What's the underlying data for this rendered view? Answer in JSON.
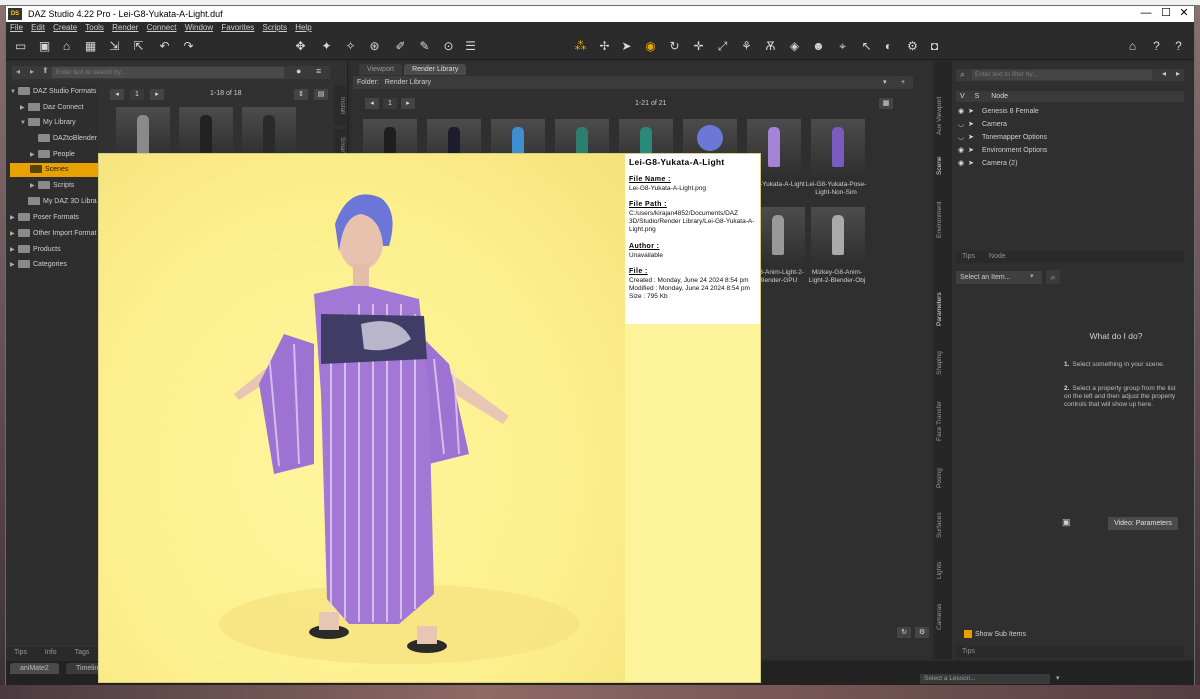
{
  "window": {
    "title": "DAZ Studio 4.22 Pro - Lei-G8-Yukata-A-Light.duf",
    "controls": {
      "minimize": "—",
      "maximize": "☐",
      "close": "✕"
    }
  },
  "menu": [
    "File",
    "Edit",
    "Create",
    "Tools",
    "Render",
    "Connect",
    "Window",
    "Favorites",
    "Scripts",
    "Help"
  ],
  "content_library": {
    "search_placeholder": "Enter text to search by...",
    "page_indicator": "1",
    "page_range": "1-18 of 18",
    "tree": [
      {
        "label": "DAZ Studio Formats",
        "level": 0,
        "selected": false
      },
      {
        "label": "Daz Connect",
        "level": 1,
        "selected": false
      },
      {
        "label": "My Library",
        "level": 1,
        "selected": false
      },
      {
        "label": "DAZtoBlender",
        "level": 2,
        "selected": false
      },
      {
        "label": "People",
        "level": 2,
        "selected": false
      },
      {
        "label": "Scenes",
        "level": 2,
        "selected": true
      },
      {
        "label": "Scripts",
        "level": 2,
        "selected": false
      },
      {
        "label": "My DAZ 3D Libra",
        "level": 1,
        "selected": false
      },
      {
        "label": "Poser Formats",
        "level": 0,
        "selected": false
      },
      {
        "label": "Other Import Format",
        "level": 0,
        "selected": false
      },
      {
        "label": "Products",
        "level": 0,
        "selected": false
      },
      {
        "label": "Categories",
        "level": 0,
        "selected": false
      }
    ],
    "bottom_tabs": [
      "Tips",
      "Info",
      "Tags"
    ],
    "side_tabs": [
      "Install",
      "Smart C"
    ]
  },
  "render_library": {
    "tabs": [
      "Viewport",
      "Render Library"
    ],
    "folder_label": "Folder:",
    "folder_value": "Render Library",
    "page_indicator": "1",
    "page_range": "1-21 of 21",
    "captions": [
      "-G8-Yukata-A-Light",
      "Lei-G8-Yukata-Pose-Light-Non-Sim",
      "-G8-Anim-Light-2-Blender-GPU",
      "Mizkey-G8-Anim-Light-2-Blender-Obj"
    ]
  },
  "scene": {
    "search_placeholder": "Enter text to filter by...",
    "header": {
      "v": "V",
      "s": "S",
      "node": "Node"
    },
    "nodes": [
      "Genesis 8 Female",
      "Camera",
      "Tonemapper Options",
      "Environment Options",
      "Camera (2)"
    ],
    "tabs": [
      "Tips",
      "Node"
    ],
    "side_tabs": [
      "Aux Viewport",
      "Scene",
      "Environment",
      "Parameters",
      "Shaping",
      "Face Transfer",
      "Posing",
      "Surfaces",
      "Lights",
      "Cameras"
    ]
  },
  "parameters": {
    "select_item": "Select an Item...",
    "what_do_i_do": "What do I do?",
    "steps": [
      {
        "num": "1.",
        "text": "Select something in your scene."
      },
      {
        "num": "2.",
        "text": "Select a property group from the list on the left and then adjust the property controls that will show up here."
      }
    ],
    "video_button": "Video: Parameters",
    "show_sub_items": "Show Sub Items",
    "tips_label": "Tips"
  },
  "bottom": {
    "tabs": [
      "aniMate2",
      "Timeline"
    ],
    "lesson_placeholder": "Select a Lesson..."
  },
  "preview": {
    "title": "Lei-G8-Yukata-A-Light",
    "file_name_label": "File Name :",
    "file_name": "Lei-G8-Yukata-A-Light.png",
    "file_path_label": "File Path :",
    "file_path": "C:/users/kirajan4852/Documents/DAZ 3D/Studio/Render Library/Lei-G8-Yukata-A-Light.png",
    "author_label": "Author :",
    "author": "Unavailable",
    "file_label": "File :",
    "created": "Created :  Monday, June 24 2024 8:54 pm",
    "modified": "Modified :  Monday, June 24 2024 8:54 pm",
    "size": "Size :      795 Kb"
  },
  "colors": {
    "accent": "#e7a100",
    "background": "#2b2b2b",
    "preview_bg": "#fdf39a",
    "kimono": "#9b6fd0"
  }
}
